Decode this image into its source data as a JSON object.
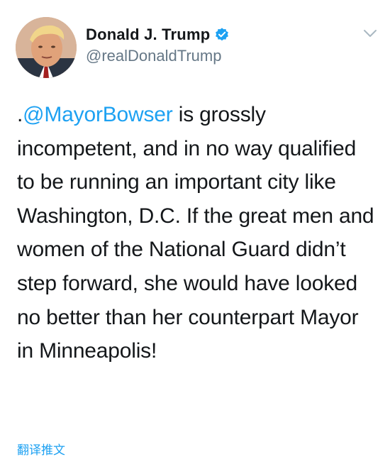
{
  "tweet": {
    "author": {
      "display_name": "Donald J. Trump",
      "handle": "@realDonaldTrump",
      "verified": true,
      "avatar_icon": "user-avatar-photo"
    },
    "menu_icon": "chevron-down-icon",
    "text": {
      "prefix": ".",
      "mention": "@MayorBowser",
      "rest": " is grossly incompetent, and in no way qualified to be running an important city like Washington, D.C. If the great men and women of the National Guard didn’t step forward, she would have looked no better than her counterpart Mayor in Minneapolis!"
    },
    "translate_label": "翻译推文"
  },
  "colors": {
    "accent": "#1da1f2",
    "text": "#14171a",
    "secondary_text": "#657786",
    "chevron": "#aab8c2"
  }
}
